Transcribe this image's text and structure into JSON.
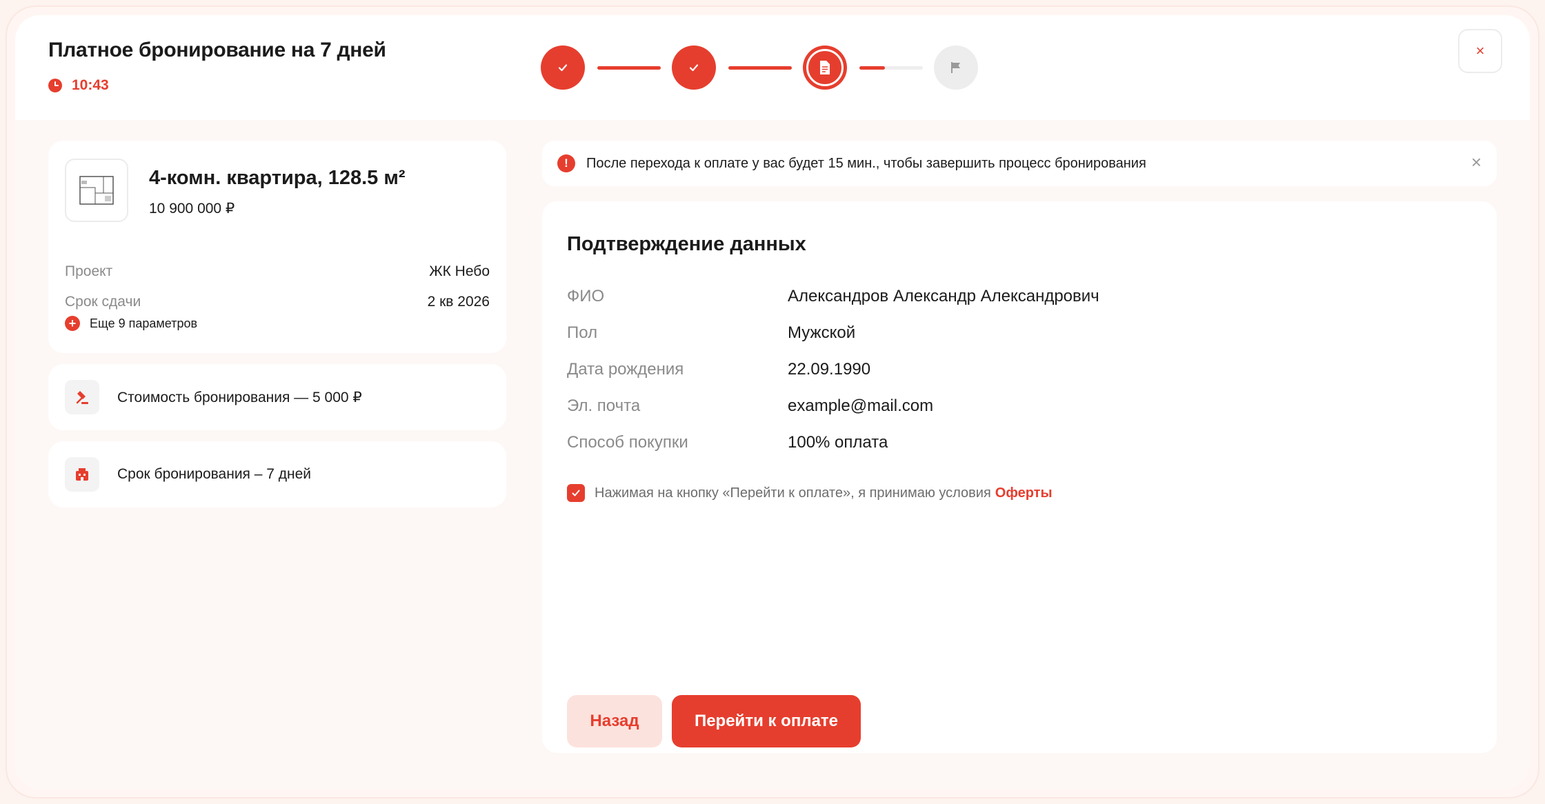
{
  "header": {
    "title": "Платное бронирование на 7 дней",
    "timer": "10:43",
    "close_icon": "×"
  },
  "stepper": {
    "steps": [
      {
        "state": "done",
        "icon": "check-icon"
      },
      {
        "state": "done",
        "icon": "check-icon"
      },
      {
        "state": "active",
        "icon": "document-icon"
      },
      {
        "state": "todo",
        "icon": "flag-icon"
      }
    ],
    "partial_progress": 0.4
  },
  "apartment": {
    "title": "4-комн. квартира, 128.5 м²",
    "price": "10 900 000 ₽",
    "params": [
      {
        "label": "Проект",
        "value": "ЖК Небо"
      },
      {
        "label": "Срок сдачи",
        "value": "2 кв 2026"
      }
    ],
    "more_label": "Еще 9 параметров"
  },
  "booking": {
    "cost": "Стоимость бронирования — 5 000 ₽",
    "term": "Срок бронирования – 7 дней"
  },
  "notice": {
    "text": "После перехода к оплате у вас будет 15 мин., чтобы завершить процесс бронирования"
  },
  "confirm": {
    "title": "Подтверждение данных",
    "rows": [
      {
        "label": "ФИО",
        "value": "Александров Александр Александрович"
      },
      {
        "label": "Пол",
        "value": "Мужской"
      },
      {
        "label": "Дата рождения",
        "value": "22.09.1990"
      },
      {
        "label": "Эл. почта",
        "value": "example@mail.com"
      },
      {
        "label": "Способ покупки",
        "value": "100% оплата"
      }
    ],
    "consent_text": "Нажимая на кнопку «Перейти к оплате», я принимаю условия",
    "consent_link": "Оферты",
    "consent_checked": true,
    "back_label": "Назад",
    "pay_label": "Перейти к оплате"
  },
  "colors": {
    "accent": "#e63e2e",
    "accent_soft": "#fce2dd",
    "text": "#1b1b1b",
    "muted": "#8a8a8a"
  }
}
